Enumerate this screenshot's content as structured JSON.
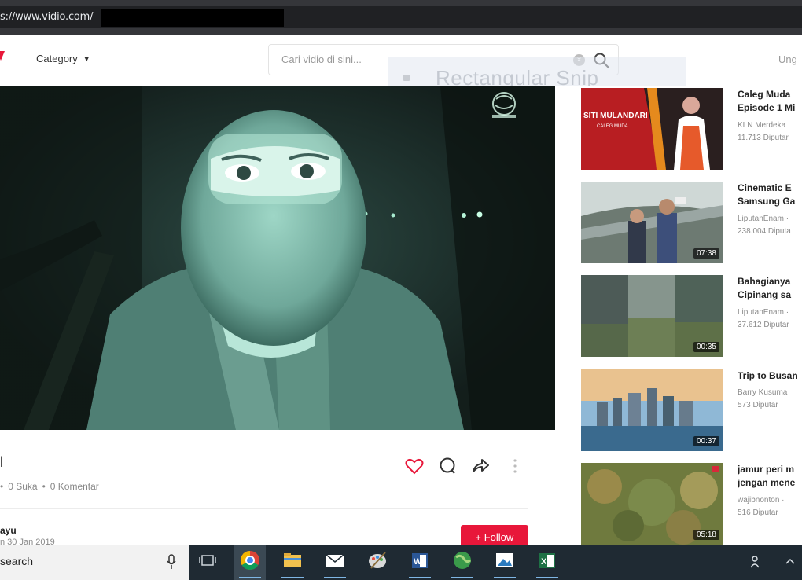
{
  "browser": {
    "url": "s://www.vidio.com/"
  },
  "header": {
    "category_label": "Category",
    "search_placeholder": "Cari vidio di sini...",
    "login_label": "Ung"
  },
  "snip_overlay": {
    "label": "Rectangular Snip"
  },
  "video": {
    "title": "l",
    "likes": "0 Suka",
    "comments": "0 Komentar",
    "channel": "ayu",
    "upload_date": "n 30 Jan 2019",
    "follow_label": "Follow",
    "watermark": "ISIS-style emblem"
  },
  "recommendations": [
    {
      "title_line1": "Caleg Muda",
      "title_line2": "Episode 1 Mi",
      "channel": "KLN Merdeka",
      "views": "11.713 Diputar",
      "duration": "",
      "thumb_text": "SITI MULANDARI",
      "thumb_subtext": "CALEG MUDA"
    },
    {
      "title_line1": "Cinematic E",
      "title_line2": "Samsung Ga",
      "channel": "LiputanEnam ·",
      "views": "238.004 Diputa",
      "duration": "07:38"
    },
    {
      "title_line1": "Bahagianya",
      "title_line2": "Cipinang sa",
      "channel": "LiputanEnam ·",
      "views": "37.612 Diputar",
      "duration": "00:35"
    },
    {
      "title_line1": "Trip to Busan",
      "title_line2": "",
      "channel": "Barry Kusuma",
      "views": "573 Diputar",
      "duration": "00:37"
    },
    {
      "title_line1": "jamur peri m",
      "title_line2": "jengan mene",
      "channel": "wajibnonton ·",
      "views": "516 Diputar",
      "duration": "05:18"
    }
  ],
  "taskbar": {
    "search_text": "search",
    "apps": [
      "task-view",
      "chrome",
      "file-explorer",
      "mail",
      "paint",
      "word",
      "maps",
      "photos",
      "excel"
    ]
  },
  "colors": {
    "accent": "#e8173a",
    "taskbar": "#1f2a33",
    "addressbar": "#35363a"
  }
}
